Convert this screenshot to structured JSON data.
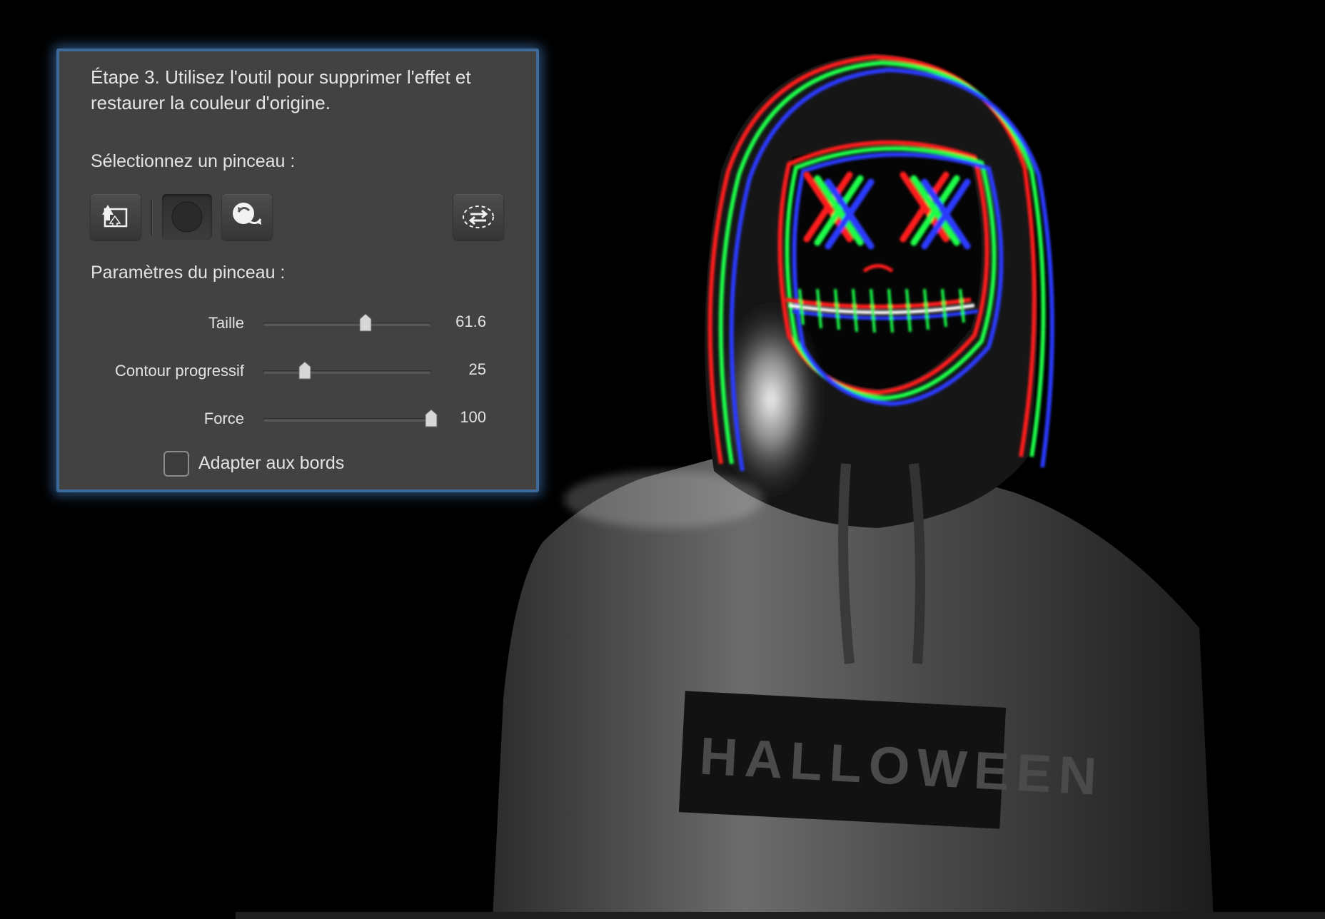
{
  "panel": {
    "step_text": "Étape 3. Utilisez l'outil pour supprimer l'effet et restaurer la couleur d'origine.",
    "brush_select_label": "Sélectionnez un pinceau :",
    "brush_params_label": "Paramètres du pinceau :",
    "tools": [
      {
        "icon": "auto-brush-icon"
      },
      {
        "icon": "round-brush-icon"
      },
      {
        "icon": "restore-brush-icon"
      },
      {
        "icon": "invert-selection-icon"
      }
    ],
    "sliders": {
      "size": {
        "label": "Taille",
        "value": "61.6",
        "fraction": 0.61
      },
      "feather": {
        "label": "Contour progressif",
        "value": "25",
        "fraction": 0.25
      },
      "strength": {
        "label": "Force",
        "value": "100",
        "fraction": 1.0
      }
    },
    "checkbox": {
      "label": "Adapter aux bords",
      "checked": false
    },
    "accent_color": "#3e6a99"
  },
  "photo": {
    "shirt_text": "HALLOWEEN",
    "neon_colors": [
      "#ff1e1e",
      "#1eff4a",
      "#2a3bff"
    ]
  }
}
